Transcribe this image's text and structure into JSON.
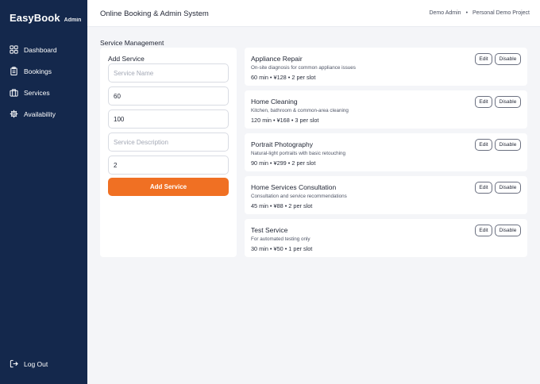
{
  "brand": {
    "name": "EasyBook",
    "tag": "Admin"
  },
  "sidebar": {
    "items": [
      {
        "label": "Dashboard",
        "icon": "grid-icon"
      },
      {
        "label": "Bookings",
        "icon": "clipboard-icon"
      },
      {
        "label": "Services",
        "icon": "briefcase-icon"
      },
      {
        "label": "Availability",
        "icon": "gear-icon"
      }
    ],
    "logout": {
      "label": "Log Out",
      "icon": "logout-icon"
    }
  },
  "header": {
    "title": "Online Booking & Admin System",
    "user": "Demo Admin",
    "separator": "•",
    "project": "Personal Demo Project"
  },
  "main": {
    "section_title": "Service Management",
    "form": {
      "title": "Add Service",
      "name": {
        "value": "",
        "placeholder": "Service Name"
      },
      "duration": {
        "value": "60",
        "placeholder": ""
      },
      "price": {
        "value": "100",
        "placeholder": ""
      },
      "description": {
        "value": "",
        "placeholder": "Service Description"
      },
      "capacity": {
        "value": "2",
        "placeholder": ""
      },
      "submit_label": "Add Service"
    },
    "services": [
      {
        "name": "Appliance Repair",
        "description": "On-site diagnosis for common appliance issues",
        "meta": "60 min  •  ¥128  •  2 per slot",
        "edit": "Edit",
        "disable": "Disable"
      },
      {
        "name": "Home Cleaning",
        "description": "Kitchen, bathroom & common-area cleaning",
        "meta": "120 min  •  ¥168  •  3 per slot",
        "edit": "Edit",
        "disable": "Disable"
      },
      {
        "name": "Portrait Photography",
        "description": "Natural-light portraits with basic retouching",
        "meta": "90 min  •  ¥299  •  2 per slot",
        "edit": "Edit",
        "disable": "Disable"
      },
      {
        "name": "Home Services Consultation",
        "description": "Consultation and service recommendations",
        "meta": "45 min  •  ¥88  •  2 per slot",
        "edit": "Edit",
        "disable": "Disable"
      },
      {
        "name": "Test Service",
        "description": "For automated testing only",
        "meta": "30 min  •  ¥50  •  1 per slot",
        "edit": "Edit",
        "disable": "Disable"
      }
    ]
  },
  "colors": {
    "sidebar": "#14284c",
    "accent": "#f07023",
    "background": "#f4f5f8"
  }
}
